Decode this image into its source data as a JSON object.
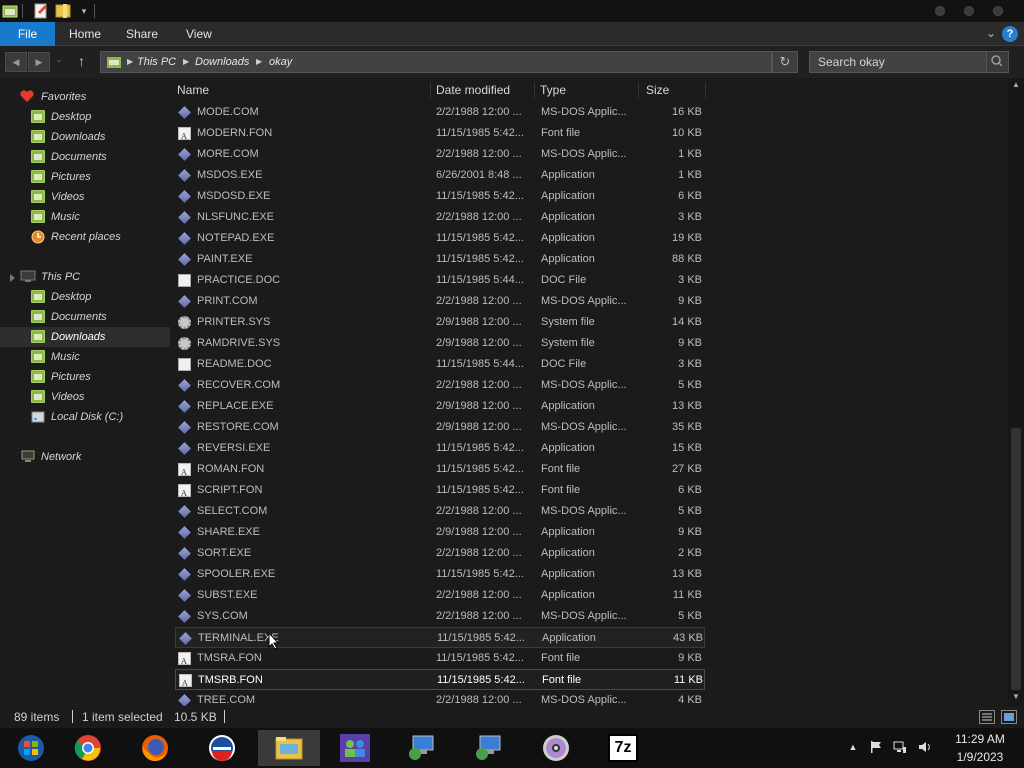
{
  "ribbon": {
    "tabs": [
      {
        "label": "File"
      },
      {
        "label": "Home"
      },
      {
        "label": "Share"
      },
      {
        "label": "View"
      }
    ],
    "help_label": "?"
  },
  "address": {
    "breadcrumbs": [
      "This PC",
      "Downloads",
      "okay"
    ]
  },
  "search": {
    "placeholder": "Search okay"
  },
  "navpane": {
    "favorites_label": "Favorites",
    "favorites": [
      "Desktop",
      "Downloads",
      "Documents",
      "Pictures",
      "Videos",
      "Music",
      "Recent places"
    ],
    "thispc_label": "This PC",
    "thispc": [
      "Desktop",
      "Documents",
      "Downloads",
      "Music",
      "Pictures",
      "Videos",
      "Local Disk (C:)"
    ],
    "network_label": "Network",
    "selected": "Downloads"
  },
  "filelist": {
    "columns": {
      "name": "Name",
      "date": "Date modified",
      "type": "Type",
      "size": "Size"
    },
    "rows": [
      {
        "name": "MODE.COM",
        "date": "2/2/1988 12:00 ...",
        "type": "MS-DOS Applic...",
        "size": "16 KB",
        "icon": "app"
      },
      {
        "name": "MODERN.FON",
        "date": "11/15/1985 5:42...",
        "type": "Font file",
        "size": "10 KB",
        "icon": "font"
      },
      {
        "name": "MORE.COM",
        "date": "2/2/1988 12:00 ...",
        "type": "MS-DOS Applic...",
        "size": "1 KB",
        "icon": "app"
      },
      {
        "name": "MSDOS.EXE",
        "date": "6/26/2001 8:48 ...",
        "type": "Application",
        "size": "1 KB",
        "icon": "app"
      },
      {
        "name": "MSDOSD.EXE",
        "date": "11/15/1985 5:42...",
        "type": "Application",
        "size": "6 KB",
        "icon": "app"
      },
      {
        "name": "NLSFUNC.EXE",
        "date": "2/2/1988 12:00 ...",
        "type": "Application",
        "size": "3 KB",
        "icon": "app"
      },
      {
        "name": "NOTEPAD.EXE",
        "date": "11/15/1985 5:42...",
        "type": "Application",
        "size": "19 KB",
        "icon": "app"
      },
      {
        "name": "PAINT.EXE",
        "date": "11/15/1985 5:42...",
        "type": "Application",
        "size": "88 KB",
        "icon": "app"
      },
      {
        "name": "PRACTICE.DOC",
        "date": "11/15/1985 5:44...",
        "type": "DOC File",
        "size": "3 KB",
        "icon": "doc"
      },
      {
        "name": "PRINT.COM",
        "date": "2/2/1988 12:00 ...",
        "type": "MS-DOS Applic...",
        "size": "9 KB",
        "icon": "app"
      },
      {
        "name": "PRINTER.SYS",
        "date": "2/9/1988 12:00 ...",
        "type": "System file",
        "size": "14 KB",
        "icon": "sys"
      },
      {
        "name": "RAMDRIVE.SYS",
        "date": "2/9/1988 12:00 ...",
        "type": "System file",
        "size": "9 KB",
        "icon": "sys"
      },
      {
        "name": "README.DOC",
        "date": "11/15/1985 5:44...",
        "type": "DOC File",
        "size": "3 KB",
        "icon": "doc"
      },
      {
        "name": "RECOVER.COM",
        "date": "2/2/1988 12:00 ...",
        "type": "MS-DOS Applic...",
        "size": "5 KB",
        "icon": "app"
      },
      {
        "name": "REPLACE.EXE",
        "date": "2/9/1988 12:00 ...",
        "type": "Application",
        "size": "13 KB",
        "icon": "app"
      },
      {
        "name": "RESTORE.COM",
        "date": "2/9/1988 12:00 ...",
        "type": "MS-DOS Applic...",
        "size": "35 KB",
        "icon": "app"
      },
      {
        "name": "REVERSI.EXE",
        "date": "11/15/1985 5:42...",
        "type": "Application",
        "size": "15 KB",
        "icon": "app"
      },
      {
        "name": "ROMAN.FON",
        "date": "11/15/1985 5:42...",
        "type": "Font file",
        "size": "27 KB",
        "icon": "font"
      },
      {
        "name": "SCRIPT.FON",
        "date": "11/15/1985 5:42...",
        "type": "Font file",
        "size": "6 KB",
        "icon": "font"
      },
      {
        "name": "SELECT.COM",
        "date": "2/2/1988 12:00 ...",
        "type": "MS-DOS Applic...",
        "size": "5 KB",
        "icon": "app"
      },
      {
        "name": "SHARE.EXE",
        "date": "2/9/1988 12:00 ...",
        "type": "Application",
        "size": "9 KB",
        "icon": "app"
      },
      {
        "name": "SORT.EXE",
        "date": "2/2/1988 12:00 ...",
        "type": "Application",
        "size": "2 KB",
        "icon": "app"
      },
      {
        "name": "SPOOLER.EXE",
        "date": "11/15/1985 5:42...",
        "type": "Application",
        "size": "13 KB",
        "icon": "app"
      },
      {
        "name": "SUBST.EXE",
        "date": "2/2/1988 12:00 ...",
        "type": "Application",
        "size": "11 KB",
        "icon": "app"
      },
      {
        "name": "SYS.COM",
        "date": "2/2/1988 12:00 ...",
        "type": "MS-DOS Applic...",
        "size": "5 KB",
        "icon": "app"
      },
      {
        "name": "TERMINAL.EXE",
        "date": "11/15/1985 5:42...",
        "type": "Application",
        "size": "43 KB",
        "icon": "app",
        "state": "hover"
      },
      {
        "name": "TMSRA.FON",
        "date": "11/15/1985 5:42...",
        "type": "Font file",
        "size": "9 KB",
        "icon": "font"
      },
      {
        "name": "TMSRB.FON",
        "date": "11/15/1985 5:42...",
        "type": "Font file",
        "size": "11 KB",
        "icon": "font",
        "state": "selected"
      },
      {
        "name": "TREE.COM",
        "date": "2/2/1988 12:00 ...",
        "type": "MS-DOS Applic...",
        "size": "4 KB",
        "icon": "app"
      }
    ]
  },
  "status": {
    "item_count": "89 items",
    "selection": "1 item selected",
    "selection_size": "10.5 KB"
  },
  "taskbar": {
    "apps": [
      "start-orb",
      "chrome",
      "firefox",
      "opera",
      "file-explorer",
      "network-people",
      "remote-desktop-1",
      "remote-desktop-2",
      "dvd",
      "7zip"
    ],
    "active": "file-explorer",
    "sevenzip_label": "7z",
    "time": "11:29 AM",
    "date": "1/9/2023"
  },
  "colors": {
    "file_tab": "#1979ca",
    "folder_green": "#8bb84b",
    "background": "#1b1b1b"
  }
}
